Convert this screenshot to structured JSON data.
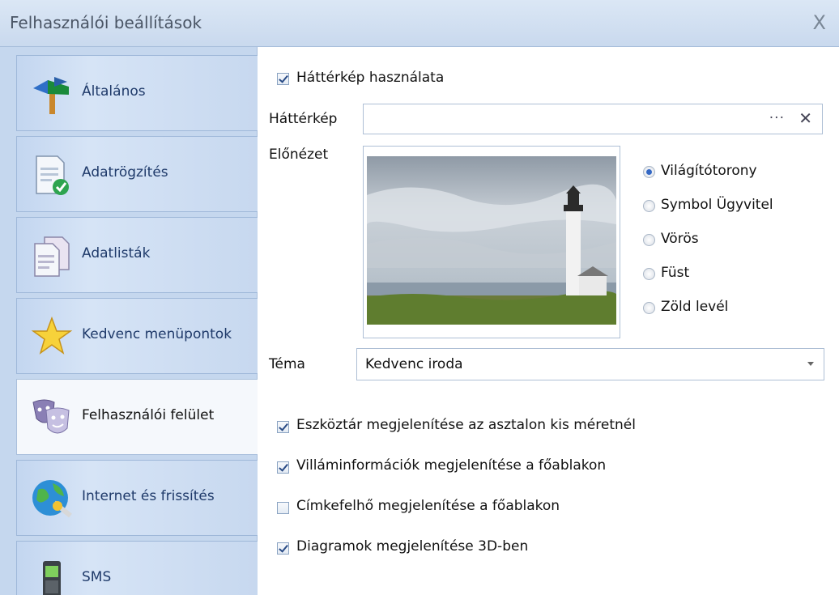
{
  "window": {
    "title": "Felhasználói beállítások",
    "close_label": "X"
  },
  "sidebar": {
    "items": [
      {
        "label": "Általános",
        "icon": "signpost-icon"
      },
      {
        "label": "Adatrögzítés",
        "icon": "document-check-icon"
      },
      {
        "label": "Adatlisták",
        "icon": "documents-icon"
      },
      {
        "label": "Kedvenc menüpontok",
        "icon": "star-icon"
      },
      {
        "label": "Felhasználói felület",
        "icon": "theater-masks-icon"
      },
      {
        "label": "Internet és frissítés",
        "icon": "globe-update-icon"
      },
      {
        "label": "SMS",
        "icon": "mobile-phone-icon"
      }
    ],
    "active_index": 4
  },
  "main": {
    "use_background": {
      "label": "Háttérkép használata",
      "checked": true
    },
    "background_field": {
      "label": "Háttérkép",
      "value": "",
      "browse_label": "···",
      "clear_label": "✕"
    },
    "preview": {
      "label": "Előnézet"
    },
    "themes": {
      "options": [
        "Világítótorony",
        "Symbol Ügyvitel",
        "Vörös",
        "Füst",
        "Zöld levél"
      ],
      "selected": "Világítótorony"
    },
    "tema": {
      "label": "Téma",
      "value": "Kedvenc iroda"
    },
    "checkboxes": [
      {
        "label": "Eszköztár megjelenítése az asztalon kis méretnél",
        "checked": true
      },
      {
        "label": "Villáminformációk megjelenítése a főablakon",
        "checked": true
      },
      {
        "label": "Címkefelhő megjelenítése a főablakon",
        "checked": false
      },
      {
        "label": "Diagramok megjelenítése 3D-ben",
        "checked": true
      }
    ]
  },
  "colors": {
    "sidebar_bg": "#c5d7ee",
    "accent": "#3468c4",
    "label_blue": "#1f3a6a"
  }
}
